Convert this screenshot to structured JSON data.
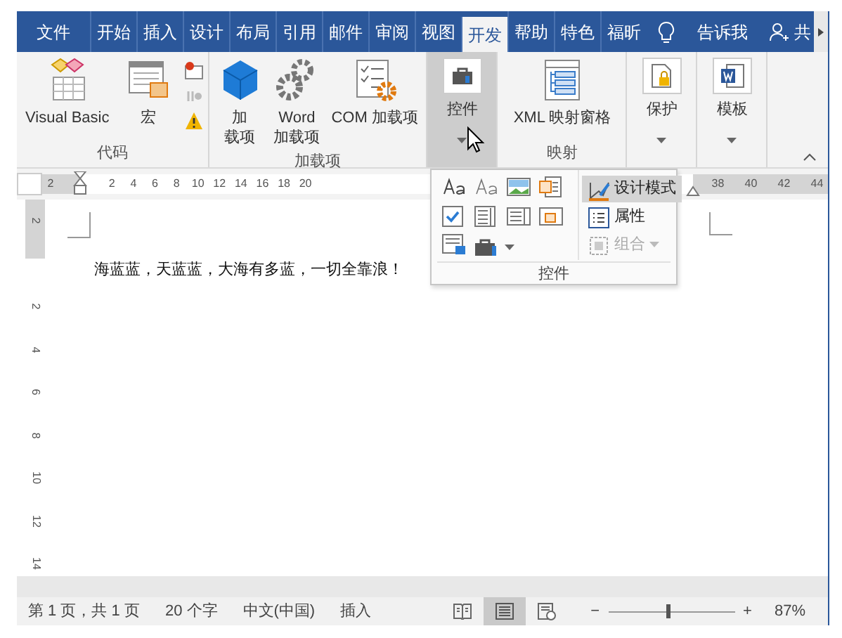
{
  "tabs": [
    {
      "label": "文件",
      "selected": false
    },
    {
      "label": "开始",
      "selected": false
    },
    {
      "label": "插入",
      "selected": false
    },
    {
      "label": "设计",
      "selected": false
    },
    {
      "label": "布局",
      "selected": false
    },
    {
      "label": "引用",
      "selected": false
    },
    {
      "label": "邮件",
      "selected": false
    },
    {
      "label": "审阅",
      "selected": false
    },
    {
      "label": "视图",
      "selected": false
    },
    {
      "label": "开发",
      "selected": true
    },
    {
      "label": "帮助",
      "selected": false
    },
    {
      "label": "特色",
      "selected": false
    },
    {
      "label": "福昕",
      "selected": false
    }
  ],
  "tell_me": "告诉我",
  "share": "共",
  "ribbon": {
    "groups": [
      {
        "kind": "group",
        "label": "代码",
        "buttons": [
          {
            "lines": [
              "Visual Basic"
            ]
          },
          {
            "lines": [
              "宏"
            ]
          }
        ]
      },
      {
        "kind": "group",
        "label": "加载项",
        "buttons": [
          {
            "lines": [
              "加",
              "载项"
            ]
          },
          {
            "lines": [
              "Word",
              "加载项"
            ]
          },
          {
            "lines": [
              "COM 加载项"
            ]
          }
        ]
      },
      {
        "kind": "collapsed",
        "label": "控件",
        "pressed": true
      },
      {
        "kind": "group",
        "label": "映射",
        "buttons": [
          {
            "lines": [
              "XML 映射窗格"
            ]
          }
        ]
      },
      {
        "kind": "collapsed",
        "label": "保护",
        "pressed": false
      },
      {
        "kind": "collapsed",
        "label": "模板",
        "pressed": false
      }
    ]
  },
  "controls_menu": {
    "commands": [
      {
        "label": "设计模式",
        "selected": true,
        "disabled": false,
        "dropdown": false
      },
      {
        "label": "属性",
        "selected": false,
        "disabled": false,
        "dropdown": false
      },
      {
        "label": "组合",
        "selected": false,
        "disabled": true,
        "dropdown": true
      }
    ],
    "footer": "控件"
  },
  "ruler": {
    "left_numbers": [
      "2"
    ],
    "numbers": [
      "2",
      "4",
      "6",
      "8",
      "10",
      "12",
      "14",
      "16",
      "18",
      "20"
    ],
    "right_numbers": [
      "38",
      "40",
      "42",
      "44"
    ]
  },
  "vertical_ruler": [
    "2",
    "2",
    "4",
    "6",
    "8",
    "10",
    "12",
    "14"
  ],
  "document": {
    "text": "海蓝蓝，天蓝蓝，大海有多蓝，一切全靠浪！"
  },
  "status_bar": {
    "page": "第 1 页，共 1 页",
    "words": "20 个字",
    "language": "中文(中国)",
    "mode": "插入",
    "views": [
      {
        "selected": false
      },
      {
        "selected": true
      },
      {
        "selected": false
      }
    ],
    "zoom_out": "−",
    "zoom_in": "+",
    "zoom": {
      "level": 0.47,
      "reading": "87%"
    }
  }
}
